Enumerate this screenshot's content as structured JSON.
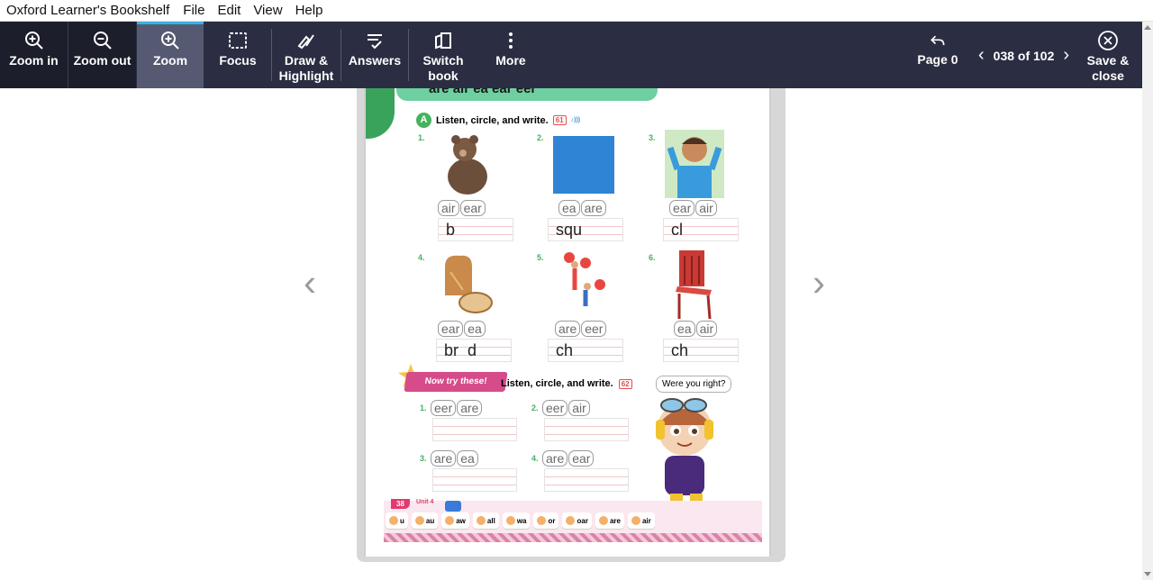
{
  "menubar": {
    "app_title": "Oxford Learner's Bookshelf",
    "items": [
      "File",
      "Edit",
      "View",
      "Help"
    ]
  },
  "toolbar": {
    "zoom_in": "Zoom in",
    "zoom_out": "Zoom out",
    "zoom": "Zoom",
    "focus": "Focus",
    "draw_1": "Draw &",
    "draw_2": "Highlight",
    "answers": "Answers",
    "switch_1": "Switch",
    "switch_2": "book",
    "more": "More",
    "page_back": "Page 0",
    "pager": "038 of 102",
    "save_1": "Save &",
    "save_2": "close",
    "accent": "#35b4e6",
    "background": "#2b2e42"
  },
  "page": {
    "title": "are air ea ear eer",
    "section_a": "Listen, circle, and write.",
    "track_a": "61",
    "items": [
      {
        "num": "1.",
        "choices": [
          "air",
          "ear"
        ],
        "answer": "b",
        "pic": "bear"
      },
      {
        "num": "2.",
        "choices": [
          "ea",
          "are"
        ],
        "answer": "squ",
        "pic": "square"
      },
      {
        "num": "3.",
        "choices": [
          "ear",
          "air"
        ],
        "answer": "cl",
        "pic": "boy"
      },
      {
        "num": "4.",
        "choices": [
          "ear",
          "ea"
        ],
        "answer": "br  d",
        "pic": "bread"
      },
      {
        "num": "5.",
        "choices": [
          "are",
          "eer"
        ],
        "answer": "ch",
        "pic": "cheer"
      },
      {
        "num": "6.",
        "choices": [
          "ea",
          "air"
        ],
        "answer": "ch",
        "pic": "chair"
      }
    ],
    "now_try": "Now try these!",
    "section_b": "Listen, circle, and write.",
    "track_b": "62",
    "bubble": "Were you right?",
    "items_b": [
      {
        "num": "1.",
        "choices": [
          "eer",
          "are"
        ]
      },
      {
        "num": "2.",
        "choices": [
          "eer",
          "air"
        ]
      },
      {
        "num": "3.",
        "choices": [
          "are",
          "ea"
        ]
      },
      {
        "num": "4.",
        "choices": [
          "are",
          "ear"
        ]
      }
    ],
    "footer_page": "38",
    "footer_unit": "Unit 4",
    "footer_chips": [
      "u",
      "au",
      "aw",
      "all",
      "wa",
      "or",
      "oar",
      "are",
      "air"
    ]
  }
}
